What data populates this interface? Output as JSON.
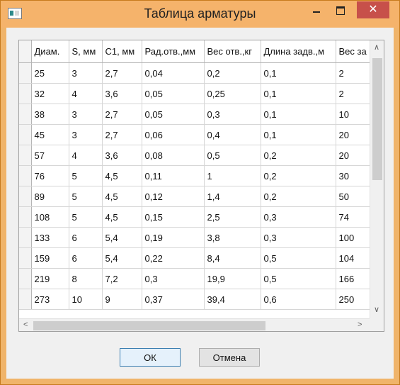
{
  "window": {
    "title": "Таблица арматуры",
    "close_glyph": "✕"
  },
  "grid": {
    "columns": [
      "Диам.",
      "S, мм",
      "C1, мм",
      "Рад.отв.,мм",
      "Вес отв.,кг",
      "Длина задв.,м",
      "Вес за"
    ],
    "rows": [
      [
        "25",
        "3",
        "2,7",
        "0,04",
        "0,2",
        "0,1",
        "2"
      ],
      [
        "32",
        "4",
        "3,6",
        "0,05",
        "0,25",
        "0,1",
        "2"
      ],
      [
        "38",
        "3",
        "2,7",
        "0,05",
        "0,3",
        "0,1",
        "10"
      ],
      [
        "45",
        "3",
        "2,7",
        "0,06",
        "0,4",
        "0,1",
        "20"
      ],
      [
        "57",
        "4",
        "3,6",
        "0,08",
        "0,5",
        "0,2",
        "20"
      ],
      [
        "76",
        "5",
        "4,5",
        "0,11",
        "1",
        "0,2",
        "30"
      ],
      [
        "89",
        "5",
        "4,5",
        "0,12",
        "1,4",
        "0,2",
        "50"
      ],
      [
        "108",
        "5",
        "4,5",
        "0,15",
        "2,5",
        "0,3",
        "74"
      ],
      [
        "133",
        "6",
        "5,4",
        "0,19",
        "3,8",
        "0,3",
        "100"
      ],
      [
        "159",
        "6",
        "5,4",
        "0,22",
        "8,4",
        "0,5",
        "104"
      ],
      [
        "219",
        "8",
        "7,2",
        "0,3",
        "19,9",
        "0,5",
        "166"
      ],
      [
        "273",
        "10",
        "9",
        "0,37",
        "39,4",
        "0,6",
        "250"
      ]
    ]
  },
  "scroll": {
    "up": "∧",
    "down": "∨",
    "left": "<",
    "right": ">"
  },
  "buttons": {
    "ok": "ОК",
    "cancel": "Отмена"
  }
}
